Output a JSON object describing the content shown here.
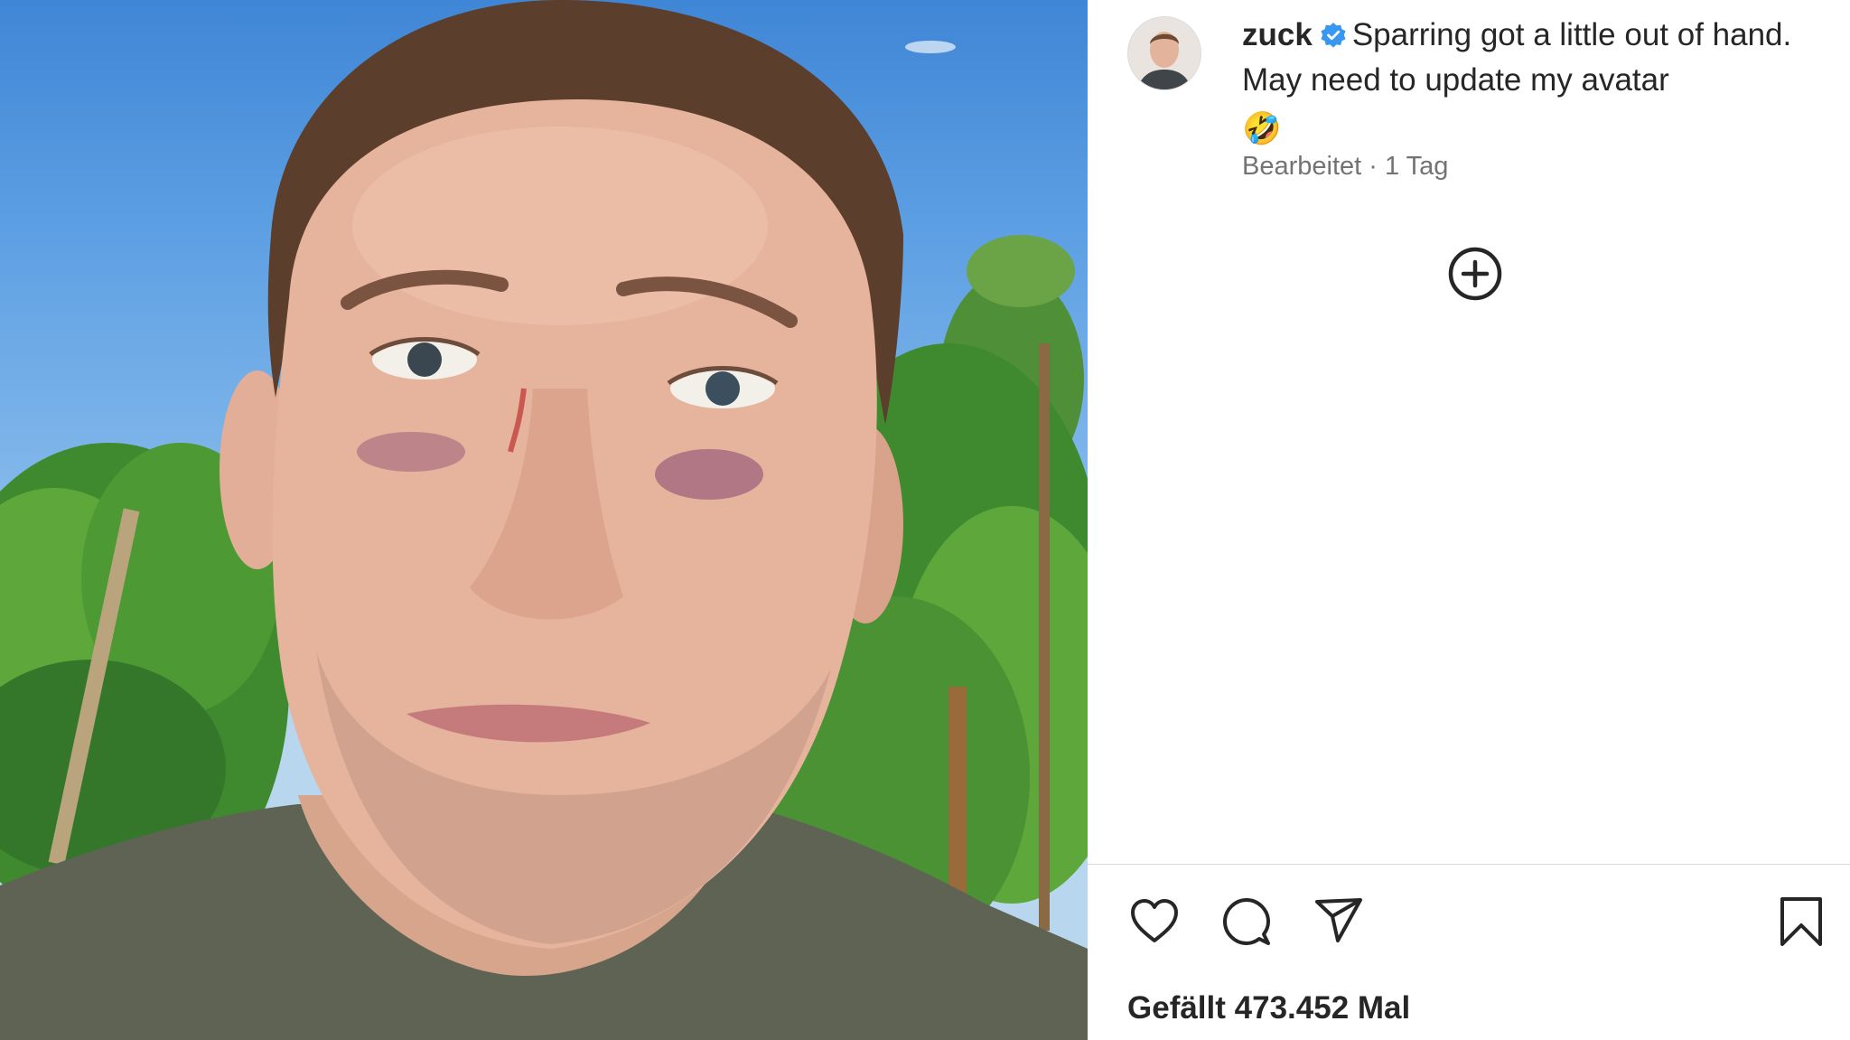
{
  "post": {
    "username": "zuck",
    "caption": "Sparring got a little out of hand. May need to update my avatar",
    "caption_emoji": "🤣",
    "edited_label": "Bearbeitet",
    "separator": "·",
    "time_ago": "1 Tag",
    "likes_text": "Gefällt 473.452 Mal"
  },
  "icons": {
    "verified": "verified-badge-icon",
    "add": "plus-circle-icon",
    "like": "heart-icon",
    "comment": "comment-icon",
    "share": "paper-plane-icon",
    "save": "bookmark-icon"
  },
  "colors": {
    "verified_blue": "#3897f0",
    "text_primary": "#262626",
    "text_secondary": "#737373",
    "divider": "#dbdbdb"
  }
}
